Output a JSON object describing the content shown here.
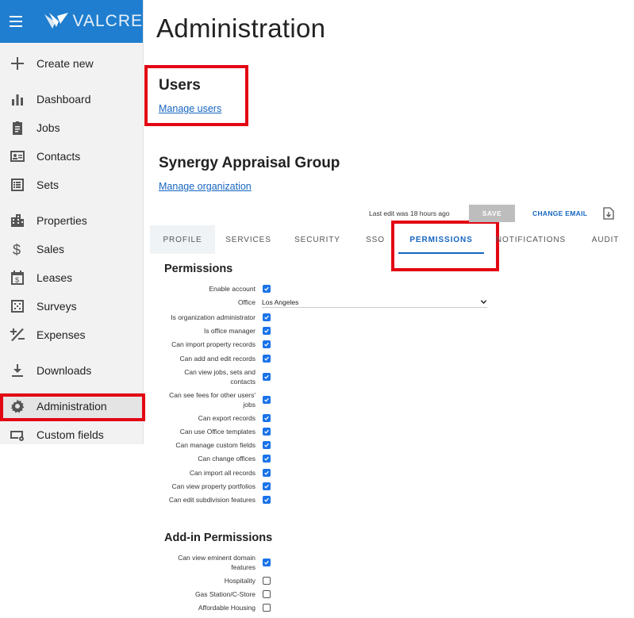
{
  "brand": {
    "name": "VALCRE"
  },
  "sidebar": {
    "items": [
      {
        "label": "Create new",
        "icon": "plus-icon"
      },
      {
        "label": "Dashboard",
        "icon": "bar-chart-icon"
      },
      {
        "label": "Jobs",
        "icon": "clipboard-icon"
      },
      {
        "label": "Contacts",
        "icon": "contact-card-icon"
      },
      {
        "label": "Sets",
        "icon": "list-icon"
      },
      {
        "label": "Properties",
        "icon": "buildings-icon"
      },
      {
        "label": "Sales",
        "icon": "dollar-icon"
      },
      {
        "label": "Leases",
        "icon": "calendar-dollar-icon"
      },
      {
        "label": "Surveys",
        "icon": "survey-grid-icon"
      },
      {
        "label": "Expenses",
        "icon": "plus-minus-icon"
      },
      {
        "label": "Downloads",
        "icon": "download-icon"
      },
      {
        "label": "Administration",
        "icon": "gear-icon"
      },
      {
        "label": "Custom fields",
        "icon": "custom-fields-icon"
      }
    ]
  },
  "main": {
    "title": "Administration",
    "users": {
      "title": "Users",
      "link": "Manage users"
    },
    "org": {
      "title": "Synergy Appraisal Group",
      "link": "Manage organization"
    },
    "toolbar": {
      "last_edit": "Last edit was 18 hours ago",
      "save": "SAVE",
      "change_email": "CHANGE EMAIL"
    },
    "tabs": [
      "PROFILE",
      "SERVICES",
      "SECURITY",
      "SSO",
      "PERMISSIONS",
      "NOTIFICATIONS",
      "AUDIT"
    ],
    "active_tab": "PERMISSIONS",
    "permissions": {
      "title": "Permissions",
      "rows": [
        {
          "label": "Enable account",
          "checked": true
        },
        {
          "label": "Office",
          "value": "Los Angeles"
        },
        {
          "label": "Is organization administrator",
          "checked": true
        },
        {
          "label": "Is office manager",
          "checked": true
        },
        {
          "label": "Can import property records",
          "checked": true
        },
        {
          "label": "Can add and edit records",
          "checked": true
        },
        {
          "label": "Can view jobs, sets and contacts",
          "checked": true
        },
        {
          "label": "Can see fees for other users' jobs",
          "checked": true
        },
        {
          "label": "Can export records",
          "checked": true
        },
        {
          "label": "Can use Office templates",
          "checked": true
        },
        {
          "label": "Can manage custom fields",
          "checked": true
        },
        {
          "label": "Can change offices",
          "checked": true
        },
        {
          "label": "Can import all records",
          "checked": true
        },
        {
          "label": "Can view property portfolios",
          "checked": true
        },
        {
          "label": "Can edit subdivision features",
          "checked": true
        }
      ]
    },
    "addins": {
      "title": "Add-in Permissions",
      "rows": [
        {
          "label": "Can view eminent domain features",
          "checked": true
        },
        {
          "label": "Hospitality",
          "checked": false
        },
        {
          "label": "Gas Station/C-Store",
          "checked": false
        },
        {
          "label": "Affordable Housing",
          "checked": false
        }
      ]
    }
  },
  "colors": {
    "brand": "#1f7ecf",
    "link": "#1565c0",
    "highlight": "#e30613",
    "checkbox": "#1a73e8"
  }
}
